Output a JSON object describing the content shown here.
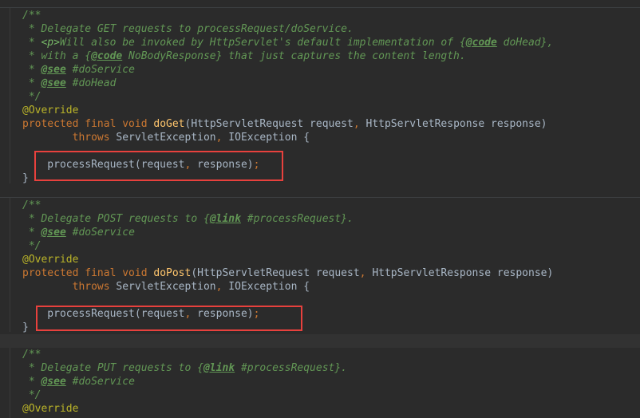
{
  "colors": {
    "background": "#2b2b2b",
    "doc_comment": "#629755",
    "keyword": "#cc7832",
    "annotation": "#bbb529",
    "method_name": "#ffc66d",
    "default_text": "#a9b7c6",
    "highlight_box": "#e8413d"
  },
  "lines": [
    [
      {
        "t": "/**",
        "c": "doc"
      }
    ],
    [
      {
        "t": " * Delegate GET requests to processRequest/doService.",
        "c": "doc"
      }
    ],
    [
      {
        "t": " * ",
        "c": "doc"
      },
      {
        "t": "<p>",
        "c": "html"
      },
      {
        "t": "Will also be invoked by HttpServlet's default implementation of {",
        "c": "doc"
      },
      {
        "t": "@code",
        "c": "tag"
      },
      {
        "t": " doHead},",
        "c": "doc"
      }
    ],
    [
      {
        "t": " * with a {",
        "c": "doc"
      },
      {
        "t": "@code",
        "c": "tag"
      },
      {
        "t": " NoBodyResponse} that just captures the content length.",
        "c": "doc"
      }
    ],
    [
      {
        "t": " * ",
        "c": "doc"
      },
      {
        "t": "@see",
        "c": "tag"
      },
      {
        "t": " #doService",
        "c": "doc"
      }
    ],
    [
      {
        "t": " * ",
        "c": "doc"
      },
      {
        "t": "@see",
        "c": "tag"
      },
      {
        "t": " #doHead",
        "c": "doc"
      }
    ],
    [
      {
        "t": " */",
        "c": "doc"
      }
    ],
    [
      {
        "t": "@Override",
        "c": "ann"
      }
    ],
    [
      {
        "t": "protected final void ",
        "c": "kw"
      },
      {
        "t": "doGet",
        "c": "fn"
      },
      {
        "t": "(HttpServletRequest request",
        "c": "def"
      },
      {
        "t": ", ",
        "c": "kw"
      },
      {
        "t": "HttpServletResponse response)",
        "c": "def"
      }
    ],
    [
      {
        "t": "        throws ",
        "c": "kw"
      },
      {
        "t": "ServletException",
        "c": "def"
      },
      {
        "t": ", ",
        "c": "kw"
      },
      {
        "t": "IOException {",
        "c": "def"
      }
    ],
    [],
    [
      {
        "t": "    processRequest(request",
        "c": "def"
      },
      {
        "t": ", ",
        "c": "kw"
      },
      {
        "t": "response)",
        "c": "def"
      },
      {
        "t": ";",
        "c": "kw"
      }
    ],
    [
      {
        "t": "}",
        "c": "def"
      }
    ],
    [],
    [
      {
        "t": "/**",
        "c": "doc"
      }
    ],
    [
      {
        "t": " * Delegate POST requests to {",
        "c": "doc"
      },
      {
        "t": "@link",
        "c": "tag"
      },
      {
        "t": " #processRequest}.",
        "c": "doc"
      }
    ],
    [
      {
        "t": " * ",
        "c": "doc"
      },
      {
        "t": "@see",
        "c": "tag"
      },
      {
        "t": " #doService",
        "c": "doc"
      }
    ],
    [
      {
        "t": " */",
        "c": "doc"
      }
    ],
    [
      {
        "t": "@Override",
        "c": "ann"
      }
    ],
    [
      {
        "t": "protected final void ",
        "c": "kw"
      },
      {
        "t": "doPost",
        "c": "fn"
      },
      {
        "t": "(HttpServletRequest request",
        "c": "def"
      },
      {
        "t": ", ",
        "c": "kw"
      },
      {
        "t": "HttpServletResponse response)",
        "c": "def"
      }
    ],
    [
      {
        "t": "        throws ",
        "c": "kw"
      },
      {
        "t": "ServletException",
        "c": "def"
      },
      {
        "t": ", ",
        "c": "kw"
      },
      {
        "t": "IOException {",
        "c": "def"
      }
    ],
    [],
    [
      {
        "t": "    processRequest(request",
        "c": "def"
      },
      {
        "t": ", ",
        "c": "kw"
      },
      {
        "t": "response)",
        "c": "def"
      },
      {
        "t": ";",
        "c": "kw"
      }
    ],
    [
      {
        "t": "}",
        "c": "def"
      }
    ],
    [],
    [
      {
        "t": "/**",
        "c": "doc"
      }
    ],
    [
      {
        "t": " * Delegate PUT requests to {",
        "c": "doc"
      },
      {
        "t": "@link",
        "c": "tag"
      },
      {
        "t": " #processRequest}.",
        "c": "doc"
      }
    ],
    [
      {
        "t": " * ",
        "c": "doc"
      },
      {
        "t": "@see",
        "c": "tag"
      },
      {
        "t": " #doService",
        "c": "doc"
      }
    ],
    [
      {
        "t": " */",
        "c": "doc"
      }
    ],
    [
      {
        "t": "@Override",
        "c": "ann"
      }
    ]
  ]
}
